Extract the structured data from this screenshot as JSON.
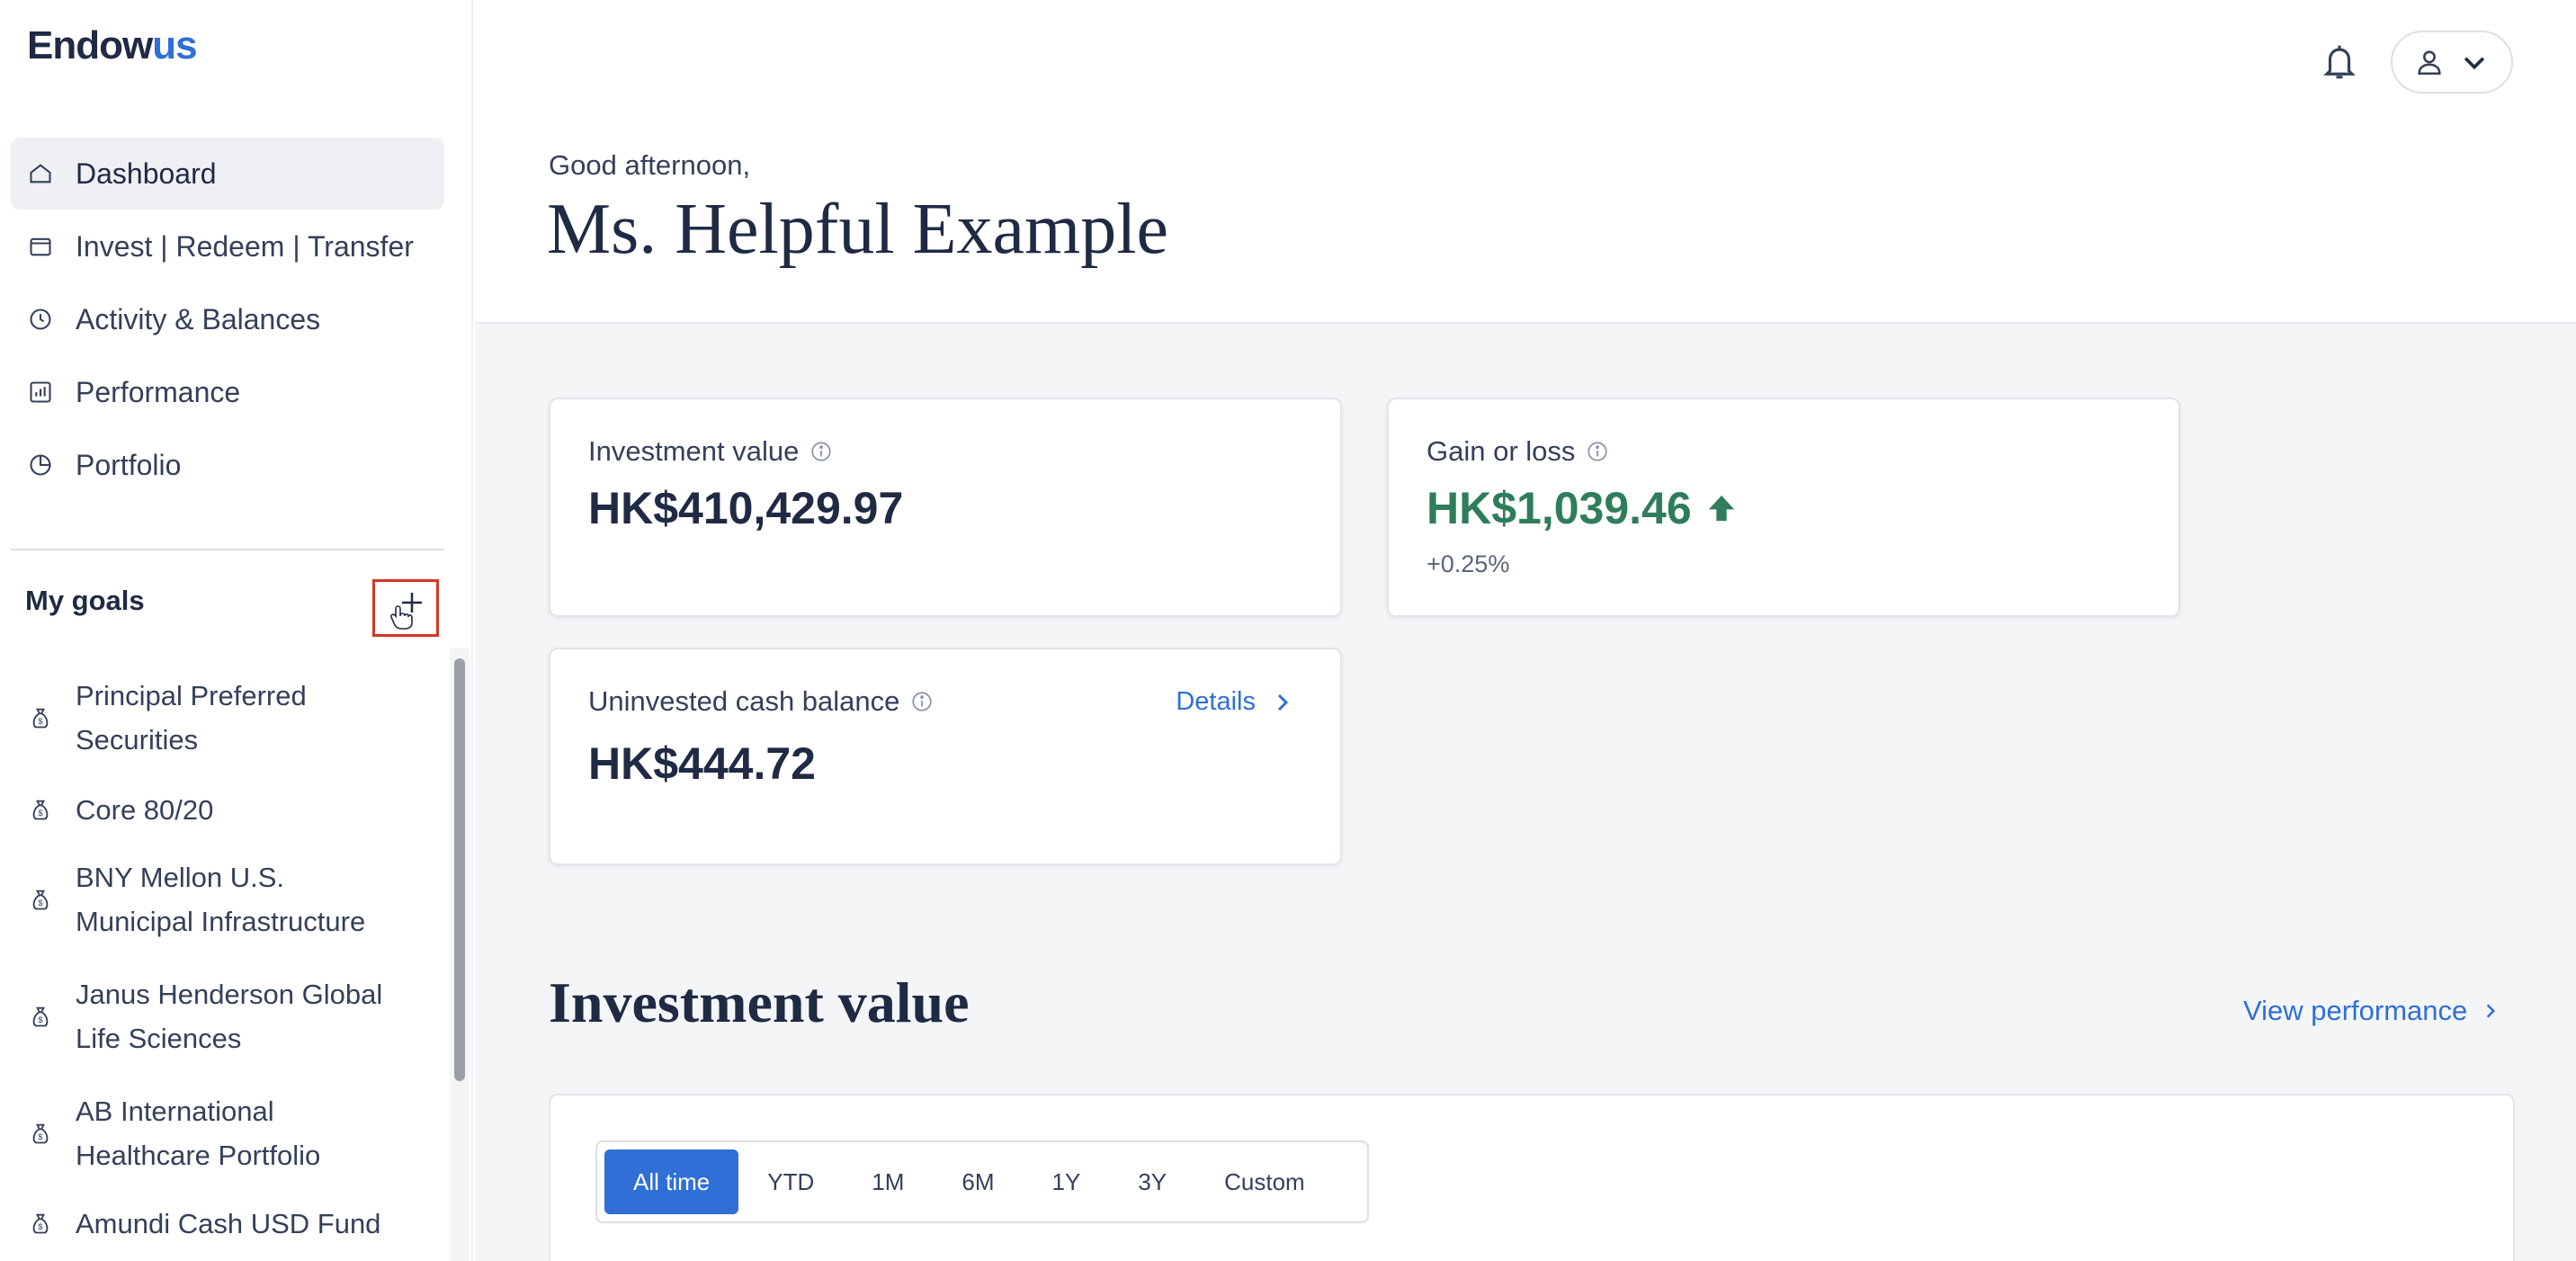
{
  "logo": {
    "prefix": "Endow",
    "accent": "us"
  },
  "nav": [
    {
      "label": "Dashboard",
      "icon": "home-icon",
      "active": true
    },
    {
      "label": "Invest | Redeem | Transfer",
      "icon": "wallet-icon"
    },
    {
      "label": "Activity & Balances",
      "icon": "clock-icon"
    },
    {
      "label": "Performance",
      "icon": "bar-chart-icon"
    },
    {
      "label": "Portfolio",
      "icon": "pie-chart-icon"
    }
  ],
  "goals": {
    "title": "My goals",
    "items": [
      {
        "line1": "Principal Preferred",
        "line2": "Securities"
      },
      {
        "line1": "Core 80/20",
        "line2": ""
      },
      {
        "line1": "BNY Mellon U.S.",
        "line2": "Municipal Infrastructure"
      },
      {
        "line1": "Janus Henderson Global",
        "line2": "Life Sciences"
      },
      {
        "line1": "AB International",
        "line2": "Healthcare Portfolio"
      },
      {
        "line1": "Amundi Cash USD Fund",
        "line2": ""
      }
    ]
  },
  "header": {
    "greeting": "Good afternoon,",
    "name": "Ms. Helpful Example"
  },
  "cards": {
    "investment_value": {
      "label": "Investment value",
      "value": "HK$410,429.97"
    },
    "gain_loss": {
      "label": "Gain or loss",
      "value": "HK$1,039.46",
      "percent": "+0.25%",
      "color": "#2e7d5b"
    },
    "cash": {
      "label": "Uninvested cash balance",
      "value": "HK$444.72",
      "link": "Details"
    }
  },
  "section": {
    "title": "Investment value",
    "link": "View performance"
  },
  "ranges": [
    "All time",
    "YTD",
    "1M",
    "6M",
    "1Y",
    "3Y",
    "Custom"
  ],
  "colors": {
    "accent": "#2f6fd6",
    "text": "#1f2a44",
    "positive": "#2e7d5b",
    "highlight": "#d0382b"
  }
}
